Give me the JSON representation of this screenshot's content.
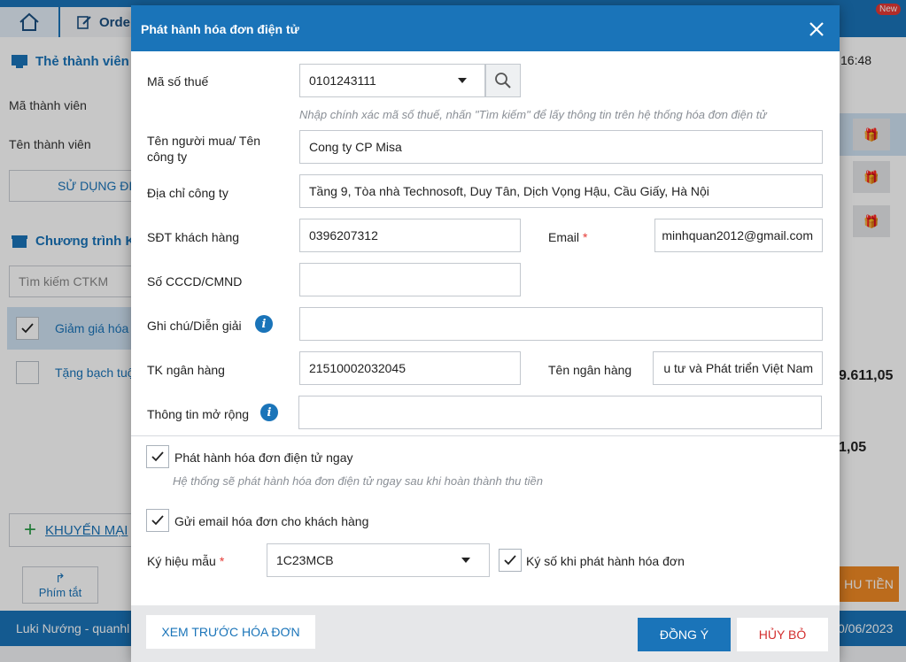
{
  "app": {
    "tab_order_label": "Orde",
    "new_badge": "New",
    "time": "16:48",
    "left_panel": {
      "member_section_title": "Thẻ thành viên",
      "member_code_label": "Mã thành viên",
      "member_name_label": "Tên thành viên",
      "use_button": "SỬ DỤNG ĐI",
      "promo_section_title": "Chương trình K",
      "promo_search_placeholder": "Tìm kiếm CTKM",
      "promos": [
        {
          "label": "Giảm giá hóa",
          "checked": true
        },
        {
          "label": "Tặng bạch tuộ",
          "checked": false
        }
      ],
      "add_promo_button": "KHUYẾN MẠI",
      "shortcut_button": "Phím tắt"
    },
    "right_panel": {
      "amount_total": "9.611,05",
      "amount_paid": "1,05",
      "pay_button": "HU TIỀN"
    },
    "status_bar": {
      "user": "Luki Nướng - quanhl",
      "date": "0/06/2023"
    }
  },
  "modal": {
    "title": "Phát hành hóa đơn điện tử",
    "tax_code": {
      "label": "Mã số thuế",
      "value": "0101243111",
      "hint": "Nhập chính xác mã số thuế, nhấn \"Tìm kiếm\" để lấy thông tin trên hệ thống hóa đơn điện tử"
    },
    "buyer_name": {
      "label": "Tên người mua/ Tên công ty",
      "value": "Cong ty CP Misa"
    },
    "address": {
      "label": "Địa chỉ công ty",
      "value": "Tầng 9, Tòa nhà Technosoft, Duy Tân, Dịch Vọng Hậu, Cầu Giấy, Hà Nội"
    },
    "phone": {
      "label": "SĐT khách hàng",
      "value": "0396207312"
    },
    "email": {
      "label": "Email",
      "value": "minhquan2012@gmail.com",
      "required": true
    },
    "id_card": {
      "label": "Số CCCD/CMND",
      "value": ""
    },
    "note": {
      "label": "Ghi chú/Diễn giải",
      "value": ""
    },
    "bank_account": {
      "label": "TK ngân hàng",
      "value": "21510002032045"
    },
    "bank_name": {
      "label": "Tên ngân hàng",
      "value": "u tư và Phát triển Việt Nam"
    },
    "extra_info": {
      "label": "Thông tin mở rộng",
      "value": ""
    },
    "issue_now": {
      "label": "Phát hành hóa đơn điện tử ngay",
      "checked": true,
      "hint": "Hệ thống sẽ phát hành hóa đơn điện tử ngay sau khi hoàn thành thu tiền"
    },
    "send_email": {
      "label": "Gửi email hóa đơn cho khách hàng",
      "checked": true
    },
    "template_symbol": {
      "label": "Ký hiệu mẫu",
      "value": "1C23MCB",
      "required": true
    },
    "sign_on_issue": {
      "label": "Ký số khi phát hành hóa đơn",
      "checked": true
    },
    "buttons": {
      "preview": "XEM TRƯỚC HÓA ĐƠN",
      "ok": "ĐỒNG Ý",
      "cancel": "HỦY BỎ"
    }
  },
  "colors": {
    "primary": "#1a74b9",
    "danger": "#d32f2f",
    "accent_orange": "#f08a24"
  }
}
